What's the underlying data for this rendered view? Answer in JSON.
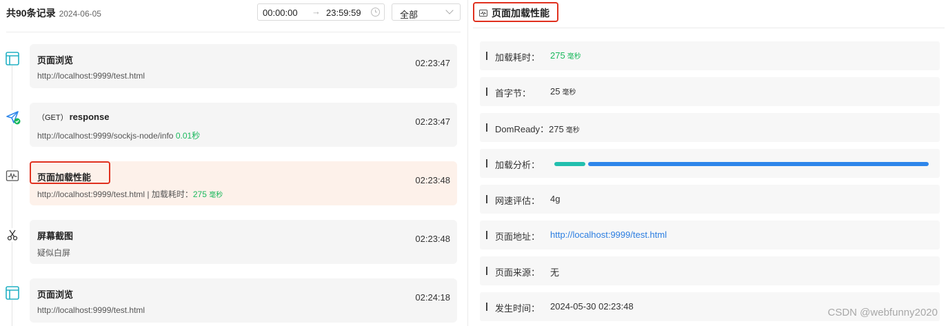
{
  "header": {
    "count_label": "共90条记录",
    "date": "2024-06-05",
    "time_start": "00:00:00",
    "time_arrow": "→",
    "time_end": "23:59:59",
    "filter_value": "全部"
  },
  "records": [
    {
      "icon": "browser-window-icon",
      "title": "页面浏览",
      "sub": "http://localhost:9999/test.html",
      "time": "02:23:47"
    },
    {
      "icon": "send-request-icon",
      "method": "（GET）",
      "title": "response",
      "sub": "http://localhost:9999/sockjs-node/info",
      "duration": "0.01秒",
      "time": "02:23:47"
    },
    {
      "icon": "performance-chart-icon",
      "title": "页面加载性能",
      "sub": "http://localhost:9999/test.html | 加载耗时：",
      "load_value": "275",
      "load_unit": "毫秒",
      "time": "02:23:48"
    },
    {
      "icon": "scissors-icon",
      "title": "屏幕截图",
      "sub": "疑似白屏",
      "time": "02:23:48"
    },
    {
      "icon": "browser-window-icon",
      "title": "页面浏览",
      "sub": "http://localhost:9999/test.html",
      "time": "02:24:18"
    }
  ],
  "detail": {
    "title": "页面加载性能",
    "rows": {
      "load_time": {
        "label": "加载耗时：",
        "value": "275",
        "unit": "毫秒"
      },
      "first_byte": {
        "label": "首字节：",
        "value": "25",
        "unit": "毫秒"
      },
      "dom_ready": {
        "label": "DomReady：",
        "value": "275",
        "unit": "毫秒"
      },
      "analysis": {
        "label": "加载分析：",
        "segments": [
          {
            "color": "#22bfae",
            "fraction": 0.084
          },
          {
            "color": "#2e86ea",
            "fraction": 0.916
          }
        ]
      },
      "network": {
        "label": "网速评估：",
        "value": "4g"
      },
      "page_url": {
        "label": "页面地址：",
        "value": "http://localhost:9999/test.html"
      },
      "source": {
        "label": "页面来源：",
        "value": "无"
      },
      "occurred": {
        "label": "发生时间：",
        "value": "2024-05-30 02:23:48"
      }
    }
  },
  "watermark": "CSDN @webfunny2020",
  "colors": {
    "accent_green": "#19b85c",
    "highlight_red": "#e0301e",
    "link_blue": "#2a7de1",
    "active_card": "#fdf1ea"
  }
}
